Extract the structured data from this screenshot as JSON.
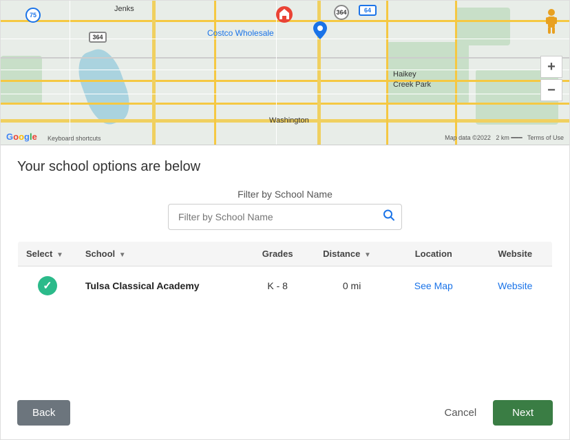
{
  "map": {
    "labels": {
      "jenks": "Jenks",
      "costco": "Costco Wholesale",
      "washington": "Washington",
      "haikey_park": "Haikey\nCreek Park",
      "keyboard_shortcuts": "Keyboard shortcuts",
      "map_data": "Map data ©2022",
      "scale": "2 km",
      "terms": "Terms of Use"
    },
    "controls": {
      "zoom_in": "+",
      "zoom_out": "−"
    }
  },
  "content": {
    "section_title": "Your school options are below",
    "filter": {
      "label": "Filter by School Name",
      "placeholder": "Filter by School Name"
    },
    "table": {
      "headers": [
        {
          "key": "select",
          "label": "Select"
        },
        {
          "key": "school",
          "label": "School"
        },
        {
          "key": "grades",
          "label": "Grades"
        },
        {
          "key": "distance",
          "label": "Distance"
        },
        {
          "key": "location",
          "label": "Location"
        },
        {
          "key": "website",
          "label": "Website"
        }
      ],
      "rows": [
        {
          "selected": true,
          "school_name": "Tulsa Classical Academy",
          "grades": "K - 8",
          "distance": "0 mi",
          "location_link": "See Map",
          "website_link": "Website"
        }
      ]
    }
  },
  "footer": {
    "back_label": "Back",
    "cancel_label": "Cancel",
    "next_label": "Next"
  }
}
